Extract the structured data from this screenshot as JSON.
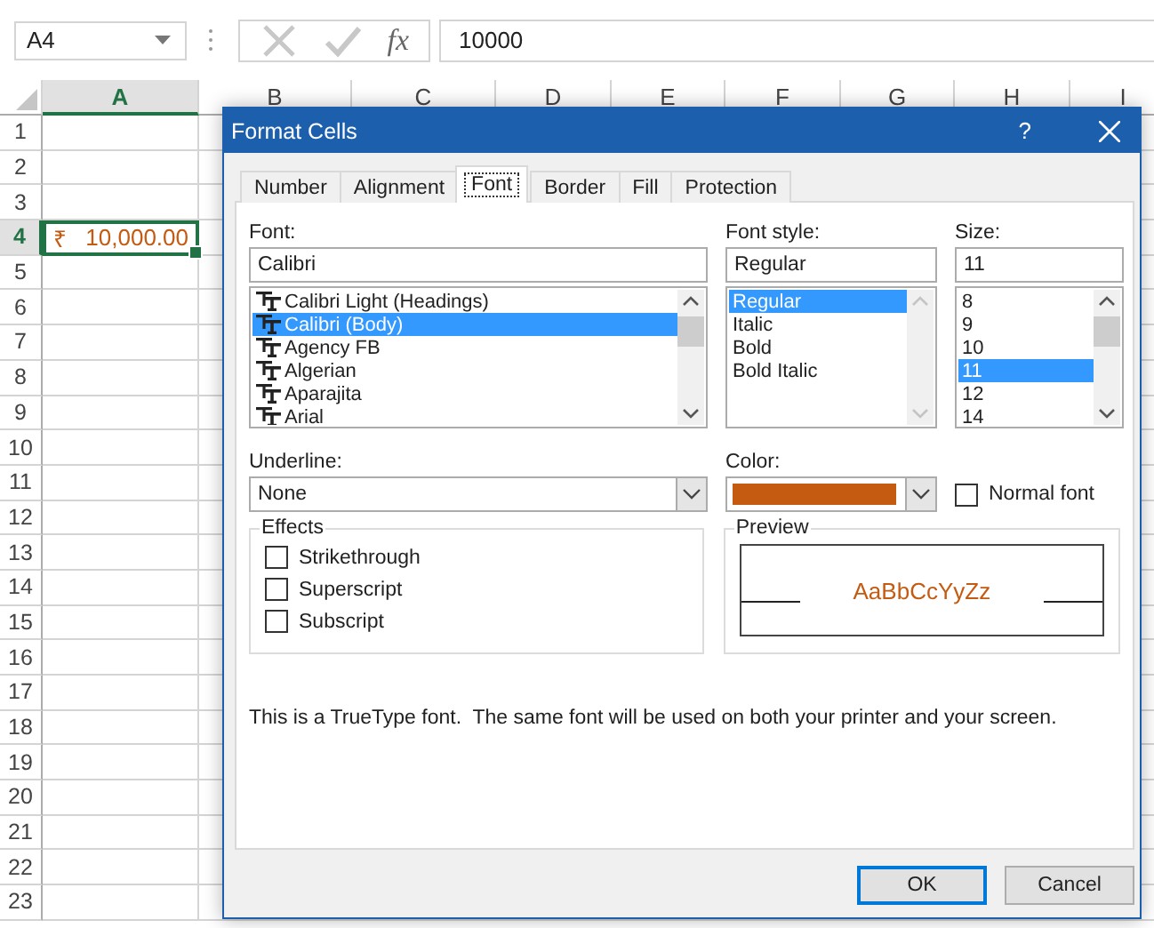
{
  "name_box": {
    "value": "A4"
  },
  "formula_bar": {
    "function_label": "fx",
    "value": "10000"
  },
  "sheet": {
    "columns": [
      {
        "label": "A",
        "selected": true
      },
      {
        "label": "B",
        "selected": false
      },
      {
        "label": "C",
        "selected": false
      },
      {
        "label": "D",
        "selected": false
      },
      {
        "label": "E",
        "selected": false
      },
      {
        "label": "F",
        "selected": false
      },
      {
        "label": "G",
        "selected": false
      },
      {
        "label": "H",
        "selected": false
      },
      {
        "label": "I",
        "selected": false
      }
    ],
    "rows": [
      {
        "label": "1",
        "selected": false
      },
      {
        "label": "2",
        "selected": false
      },
      {
        "label": "3",
        "selected": false
      },
      {
        "label": "4",
        "selected": true
      },
      {
        "label": "5",
        "selected": false
      },
      {
        "label": "6",
        "selected": false
      },
      {
        "label": "7",
        "selected": false
      },
      {
        "label": "8",
        "selected": false
      },
      {
        "label": "9",
        "selected": false
      },
      {
        "label": "10",
        "selected": false
      },
      {
        "label": "11",
        "selected": false
      },
      {
        "label": "12",
        "selected": false
      },
      {
        "label": "13",
        "selected": false
      },
      {
        "label": "14",
        "selected": false
      },
      {
        "label": "15",
        "selected": false
      },
      {
        "label": "16",
        "selected": false
      },
      {
        "label": "17",
        "selected": false
      },
      {
        "label": "18",
        "selected": false
      },
      {
        "label": "19",
        "selected": false
      },
      {
        "label": "20",
        "selected": false
      },
      {
        "label": "21",
        "selected": false
      },
      {
        "label": "22",
        "selected": false
      },
      {
        "label": "23",
        "selected": false
      }
    ],
    "active_cell": {
      "symbol": "₹",
      "value": "10,000.00"
    }
  },
  "dialog": {
    "title": "Format Cells",
    "help": "?",
    "tabs": [
      {
        "label": "Number",
        "selected": false
      },
      {
        "label": "Alignment",
        "selected": false
      },
      {
        "label": "Font",
        "selected": true
      },
      {
        "label": "Border",
        "selected": false
      },
      {
        "label": "Fill",
        "selected": false
      },
      {
        "label": "Protection",
        "selected": false
      }
    ],
    "font": {
      "label": "Font:",
      "value": "Calibri",
      "items": [
        {
          "label": "Calibri Light (Headings)",
          "selected": false
        },
        {
          "label": "Calibri (Body)",
          "selected": true
        },
        {
          "label": "Agency FB",
          "selected": false
        },
        {
          "label": "Algerian",
          "selected": false
        },
        {
          "label": "Aparajita",
          "selected": false
        },
        {
          "label": "Arial",
          "selected": false
        }
      ]
    },
    "font_style": {
      "label": "Font style:",
      "value": "Regular",
      "items": [
        {
          "label": "Regular",
          "selected": true
        },
        {
          "label": "Italic",
          "selected": false
        },
        {
          "label": "Bold",
          "selected": false
        },
        {
          "label": "Bold Italic",
          "selected": false
        }
      ]
    },
    "size": {
      "label": "Size:",
      "value": "11",
      "items": [
        {
          "label": "8",
          "selected": false
        },
        {
          "label": "9",
          "selected": false
        },
        {
          "label": "10",
          "selected": false
        },
        {
          "label": "11",
          "selected": true
        },
        {
          "label": "12",
          "selected": false
        },
        {
          "label": "14",
          "selected": false
        }
      ]
    },
    "underline": {
      "label": "Underline:",
      "value": "None"
    },
    "color": {
      "label": "Color:",
      "color": "#c55a11"
    },
    "normal_font": {
      "label": "Normal font",
      "checked": false
    },
    "effects": {
      "title": "Effects",
      "options": [
        {
          "label": "Strikethrough",
          "checked": false
        },
        {
          "label": "Superscript",
          "checked": false
        },
        {
          "label": "Subscript",
          "checked": false
        }
      ]
    },
    "preview": {
      "title": "Preview",
      "sample": "AaBbCcYyZz"
    },
    "note": "This is a TrueType font.  The same font will be used on both your printer and your screen.",
    "buttons": [
      {
        "label": "OK",
        "default": true
      },
      {
        "label": "Cancel",
        "default": false
      }
    ]
  }
}
